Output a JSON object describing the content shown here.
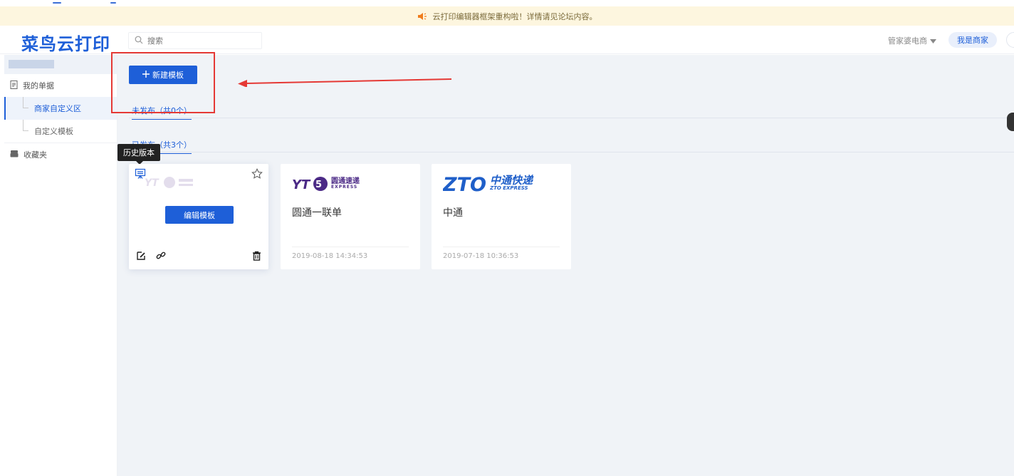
{
  "notice": {
    "text": "云打印编辑器框架重构啦！详情请见论坛内容。"
  },
  "header": {
    "logo": "菜鸟云打印",
    "search_placeholder": "搜索",
    "merchant_select": "管家婆电商",
    "merchant_button": "我是商家"
  },
  "sidebar": {
    "items": [
      {
        "label": "我的单据",
        "icon": "document-icon"
      },
      {
        "label": "商家自定义区"
      },
      {
        "label": "自定义模板"
      },
      {
        "label": "收藏夹",
        "icon": "folder-icon"
      }
    ]
  },
  "main": {
    "new_button": "新建模板",
    "tab_unpublished": "未发布（共0个）",
    "tab_published": "已发布（共3个）",
    "tooltip": "历史版本",
    "cards": [
      {
        "edit_button": "编辑模板"
      },
      {
        "name": "圆通一联单",
        "date": "2019-08-18 14:34:53",
        "logo_text": "圆通速递",
        "logo_sub": "EXPRESS"
      },
      {
        "name": "中通",
        "date": "2019-07-18 10:36:53",
        "logo_text": "中通快递",
        "logo_sub": "ZTO EXPRESS"
      }
    ]
  },
  "colors": {
    "accent": "#1e5fd8",
    "highlight": "#e53935"
  }
}
